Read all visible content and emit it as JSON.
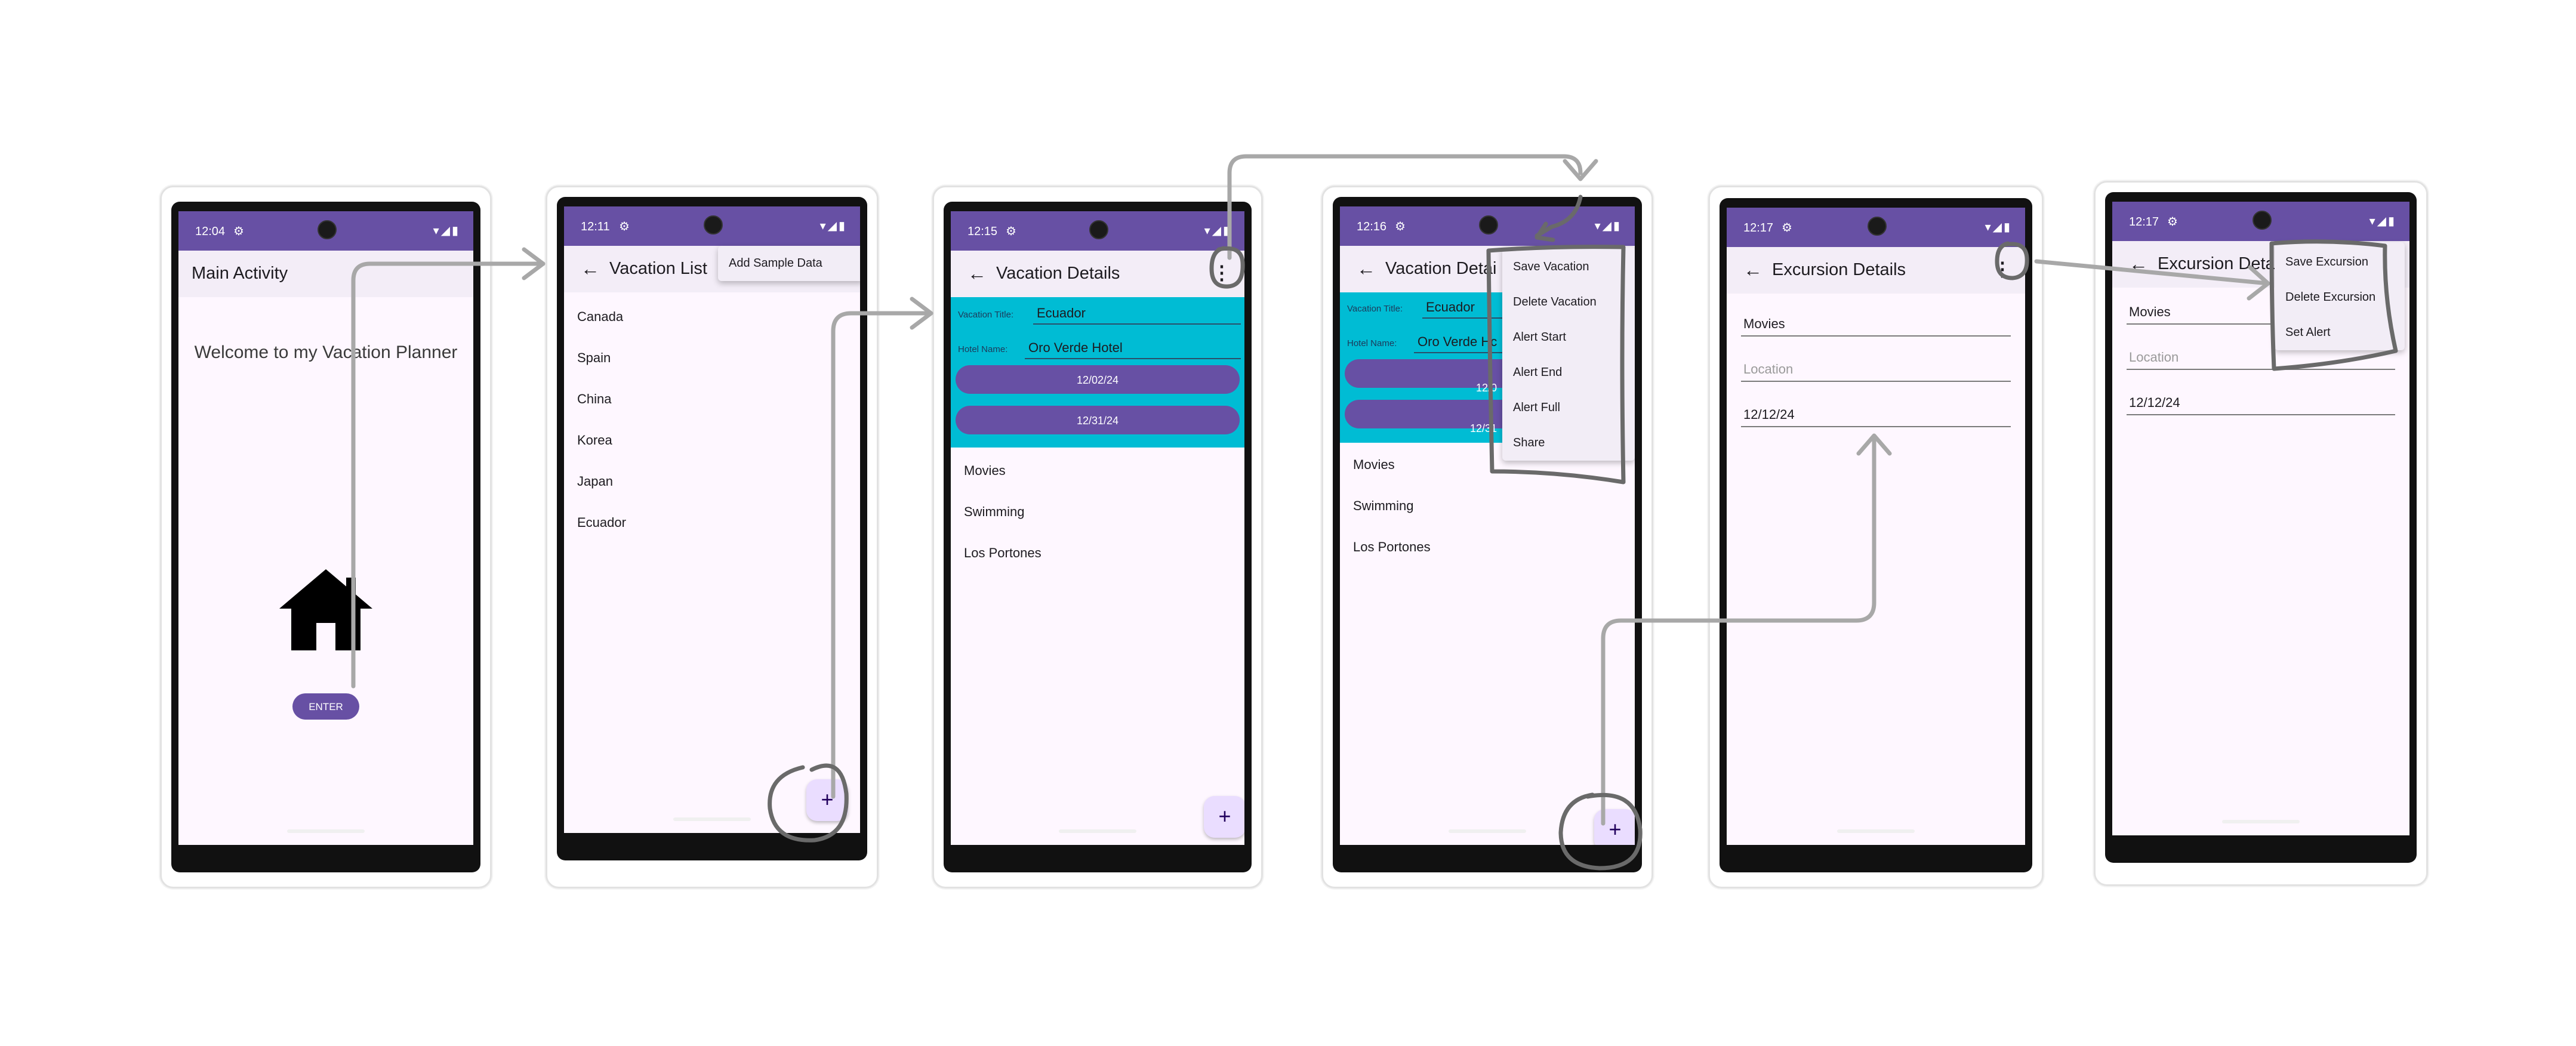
{
  "status": {
    "s1": "12:04",
    "s2": "12:11",
    "s3": "12:15",
    "s4": "12:16",
    "s5": "12:17",
    "s6": "12:17",
    "gear": "⚙",
    "icons": "▾◢▮"
  },
  "screen1": {
    "title": "Main Activity",
    "welcome": "Welcome to my Vacation Planner",
    "enter": "ENTER"
  },
  "screen2": {
    "title": "Vacation List",
    "menu_item": "Add Sample Data",
    "items": [
      "Canada",
      "Spain",
      "China",
      "Korea",
      "Japan",
      "Ecuador"
    ]
  },
  "screen3": {
    "title": "Vacation Details",
    "title_label": "Vacation Title:",
    "title_value": "Ecuador",
    "hotel_label": "Hotel Name:",
    "hotel_value": "Oro Verde Hotel",
    "start_date": "12/02/24",
    "end_date": "12/31/24",
    "excursions": [
      "Movies",
      "Swimming",
      "Los Portones"
    ]
  },
  "screen4": {
    "title": "Vacation Detai",
    "title_label": "Vacation Title:",
    "title_value": "Ecuador",
    "hotel_label": "Hotel Name:",
    "hotel_value": "Oro Verde Hc",
    "start_date": "12/0",
    "end_date": "12/31",
    "excursions": [
      "Movies",
      "Swimming",
      "Los Portones"
    ],
    "menu": [
      "Save Vacation",
      "Delete Vacation",
      "Alert Start",
      "Alert End",
      "Alert Full",
      "Share"
    ]
  },
  "screen5": {
    "title": "Excursion Details",
    "name_value": "Movies",
    "location_placeholder": "Location",
    "date_value": "12/12/24"
  },
  "screen6": {
    "title": "Excursion Detai",
    "name_value": "Movies",
    "location_placeholder": "Location",
    "date_value": "12/12/24",
    "menu": [
      "Save Excursion",
      "Delete Excursion",
      "Set Alert"
    ]
  },
  "icons": {
    "back": "←",
    "kebab": "⋮",
    "plus": "+"
  },
  "colors": {
    "primary": "#6750a4",
    "form_bg": "#00bcd4",
    "surface": "#fef7ff",
    "appbar": "#f3edf7",
    "fab": "#eaddff",
    "annotation": "#a8a8a8",
    "scribble": "#6a6a6a"
  }
}
